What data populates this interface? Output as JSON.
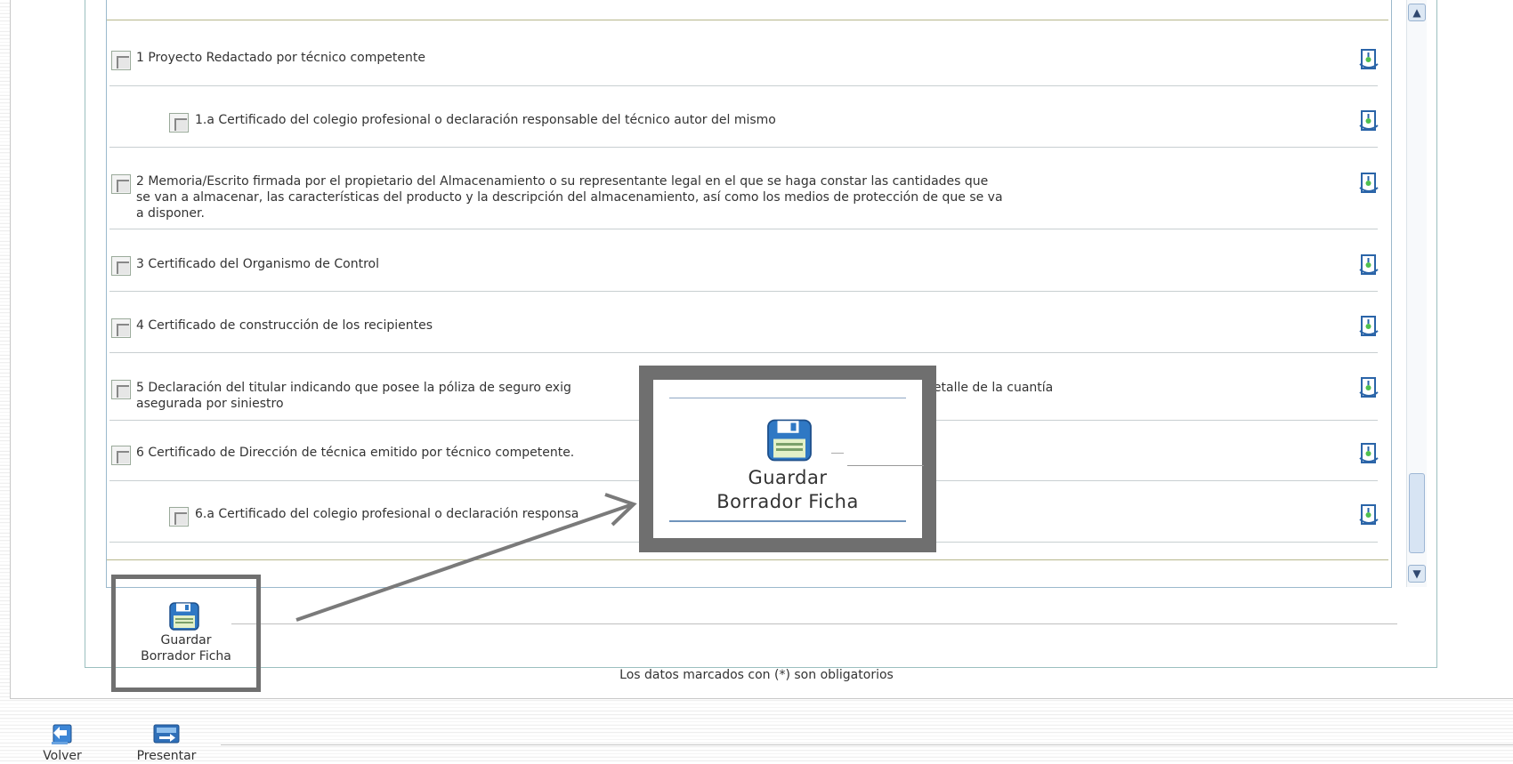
{
  "documents": [
    {
      "text": "1 Proyecto Redactado por técnico competente"
    },
    {
      "text": "1.a Certificado del colegio profesional o declaración responsable del técnico autor del mismo"
    },
    {
      "text_lines": [
        "2 Memoria/Escrito firmada por el propietario del Almacenamiento o su representante legal en el que se haga constar las cantidades que",
        "se van a almacenar, las características del producto y la descripción del almacenamiento, así como los medios de protección de que se va",
        "a disponer."
      ]
    },
    {
      "text": "3 Certificado del Organismo de Control"
    },
    {
      "text": "4 Certificado de construcción de los recipientes"
    },
    {
      "text_lines": [
        "5 Declaración del titular indicando que posee la póliza de seguro exig",
        "detalle de la cuantía",
        "asegurada por siniestro"
      ]
    },
    {
      "text": "6 Certificado de Dirección de técnica emitido por técnico competente."
    },
    {
      "text": "6.a Certificado del colegio profesional o declaración responsa"
    }
  ],
  "save_button": {
    "line1": "Guardar",
    "line2": "Borrador Ficha"
  },
  "zoom_callout": {
    "line1": "Guardar",
    "line2": "Borrador Ficha"
  },
  "required_note": "Los datos marcados con (*) son obligatorios",
  "bottom_toolbar": {
    "back_label": "Volver",
    "submit_label": "Presentar"
  },
  "icons": {
    "document": "document-download-icon",
    "save": "floppy-disk-icon",
    "back": "back-arrow-icon",
    "submit": "submit-icon"
  },
  "colors": {
    "accent_blue": "#2f78c4",
    "document_icon": "#2a64a8",
    "highlight_frame": "#707070"
  }
}
